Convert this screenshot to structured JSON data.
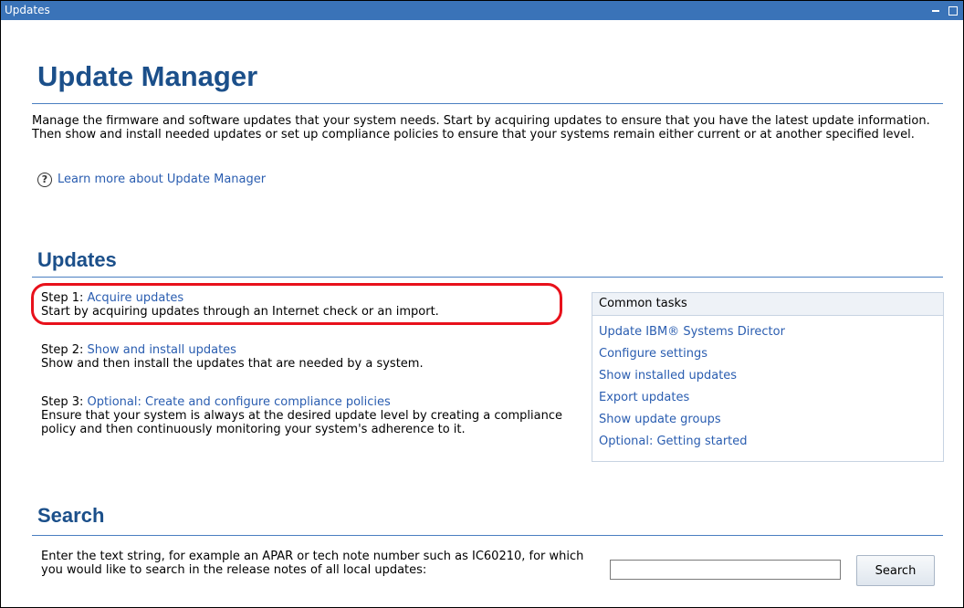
{
  "window": {
    "title": "Updates"
  },
  "page": {
    "title": "Update Manager",
    "intro": "Manage the firmware and software updates that your system needs. Start by acquiring updates to ensure that you have the latest update information. Then show and install needed updates or set up compliance policies to ensure that your systems remain either current or at another specified level.",
    "learn_more": "Learn more about Update Manager"
  },
  "updates": {
    "heading": "Updates",
    "steps": [
      {
        "prefix": "Step 1: ",
        "link": "Acquire updates",
        "desc": "Start by acquiring updates through an Internet check or an import."
      },
      {
        "prefix": "Step 2: ",
        "link": "Show and install updates",
        "desc": "Show and then install the updates that are needed by a system."
      },
      {
        "prefix": "Step 3: ",
        "link": "Optional: Create and configure compliance policies",
        "desc": "Ensure that your system is always at the desired update level by creating a compliance policy and then continuously monitoring your system's adherence to it."
      }
    ]
  },
  "common_tasks": {
    "header": "Common tasks",
    "items": [
      "Update IBM® Systems Director",
      "Configure settings",
      "Show installed updates",
      "Export updates",
      "Show update groups",
      "Optional: Getting started"
    ]
  },
  "search": {
    "heading": "Search",
    "description": "Enter the text string, for example an APAR or tech note number such as IC60210, for which you would like to search in the release notes of all local updates:",
    "input_value": "",
    "button": "Search"
  },
  "colors": {
    "titlebar": "#3a73b8",
    "heading": "#1b4f8a",
    "link": "#2a5db0",
    "highlight": "#e8111b"
  }
}
